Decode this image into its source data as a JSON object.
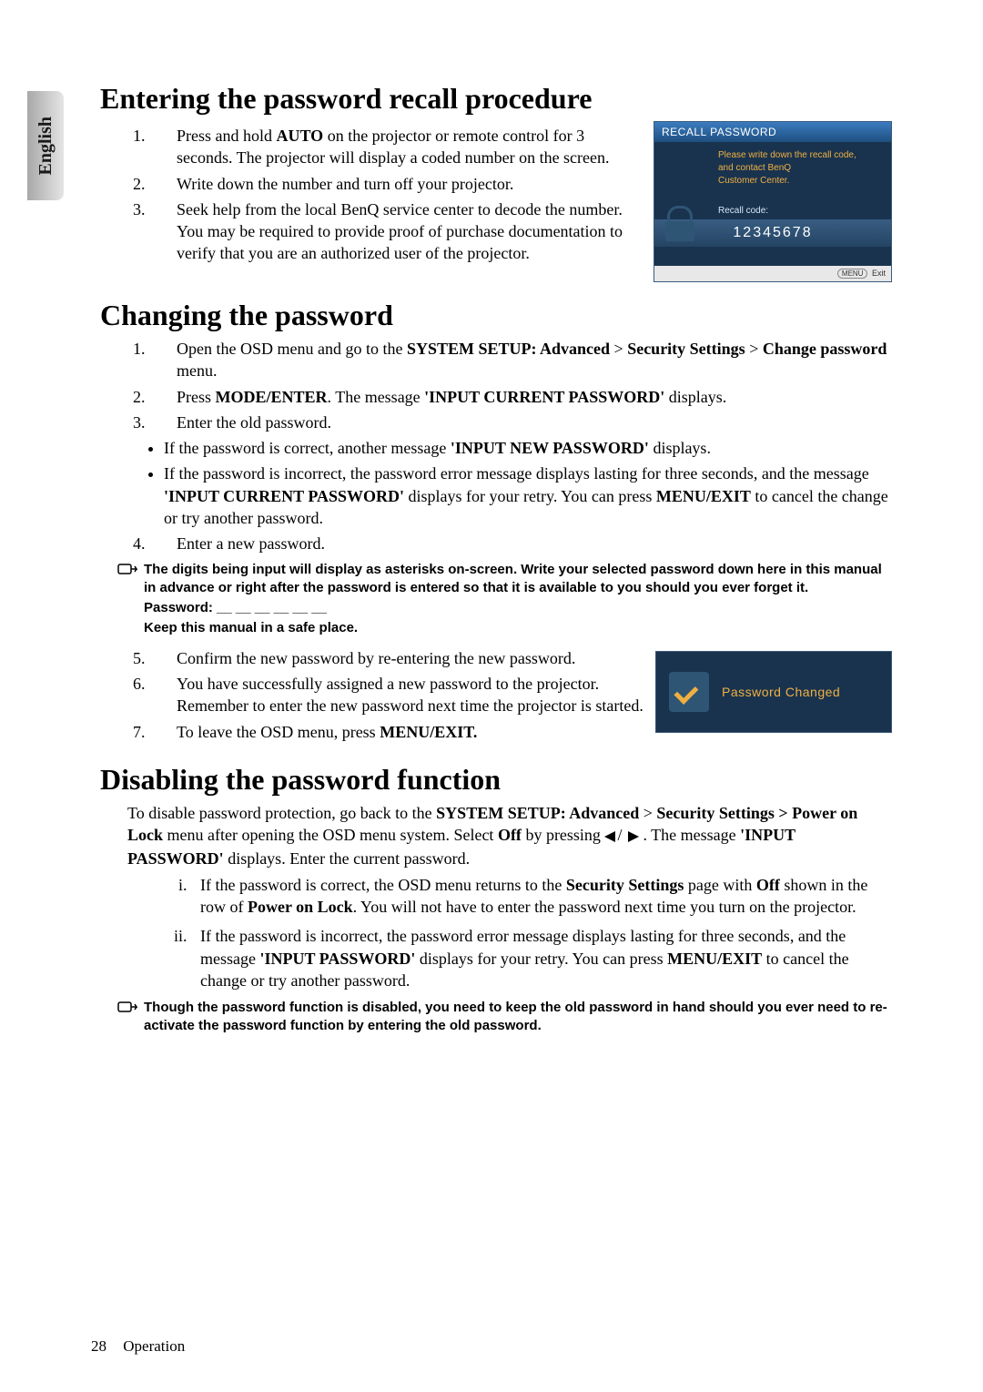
{
  "side_tab": "English",
  "section1": {
    "title": "Entering the password recall procedure",
    "steps": [
      "Press and hold <b>AUTO</b> on the projector or remote control for 3 seconds. The projector will display a coded number on the screen.",
      "Write down the number and turn off your projector.",
      "Seek help from the local BenQ service center to decode the number. You may be required to provide proof of purchase documentation to verify that you are an authorized user of the projector."
    ]
  },
  "osd_recall": {
    "title": "RECALL PASSWORD",
    "msg_l1": "Please write down the recall code,",
    "msg_l2": "and contact BenQ",
    "msg_l3": "Customer Center.",
    "code_label": "Recall code:",
    "code": "12345678",
    "footer_btn": "MENU",
    "footer_text": "Exit"
  },
  "section2": {
    "title": "Changing the password",
    "steps_1_4": [
      "Open the OSD menu and go to the <b>SYSTEM SETUP: Advanced</b> > <b>Security Settings</b> > <b>Change password</b> menu.",
      "Press <b>MODE/ENTER</b>. The message <b>'INPUT CURRENT PASSWORD'</b> displays.",
      "Enter the old password."
    ],
    "bullets": [
      "If the password is correct, another message <b>'INPUT NEW PASSWORD'</b> displays.",
      "If the password is incorrect, the password error message displays lasting for three seconds, and the message <b>'INPUT CURRENT PASSWORD'</b> displays for your retry. You can press <b>MENU/EXIT</b> to cancel the change or try another password."
    ],
    "step4": "Enter a new password.",
    "note1_l1": "The digits being input will display as asterisks on-screen. Write your selected password down here in this manual in advance or right after the password is entered so that it is available to you should you ever forget it.",
    "note1_l2": "Password: __ __ __ __ __ __",
    "note1_l3": "Keep this manual in a safe place.",
    "step5": "Confirm the new password by re-entering the new password.",
    "step6": "You have successfully assigned a new password to the projector. Remember to enter the new password next time the projector is started.",
    "step7": "To leave the OSD menu, press <b>MENU/EXIT.</b>"
  },
  "osd_changed": {
    "text": "Password Changed"
  },
  "section3": {
    "title": "Disabling the password function",
    "intro_a": "To disable password protection, go back to the <b>SYSTEM SETUP: Advanced</b> > <b>Security Settings > Power on Lock</b> menu after opening the OSD menu system. Select <b>Off</b> by pressing ",
    "intro_b": " . The message <b>'INPUT PASSWORD'</b> displays. Enter the current password.",
    "roman": [
      "If the password is correct, the OSD menu returns to the <b>Security Settings</b> page with <b>Off</b> shown in the row of <b>Power on Lock</b>. You will not have to enter the password next time you turn on the projector.",
      "If the password is incorrect, the password error message displays lasting for three seconds, and the message <b>'INPUT PASSWORD'</b> displays for your retry. You can press <b>MENU/EXIT</b> to cancel the change or try another password."
    ],
    "note2": "Though the password function is disabled, you need to keep the old password in hand should you ever need to re-activate the password function by entering the old password."
  },
  "footer": {
    "page": "28",
    "section": "Operation"
  }
}
